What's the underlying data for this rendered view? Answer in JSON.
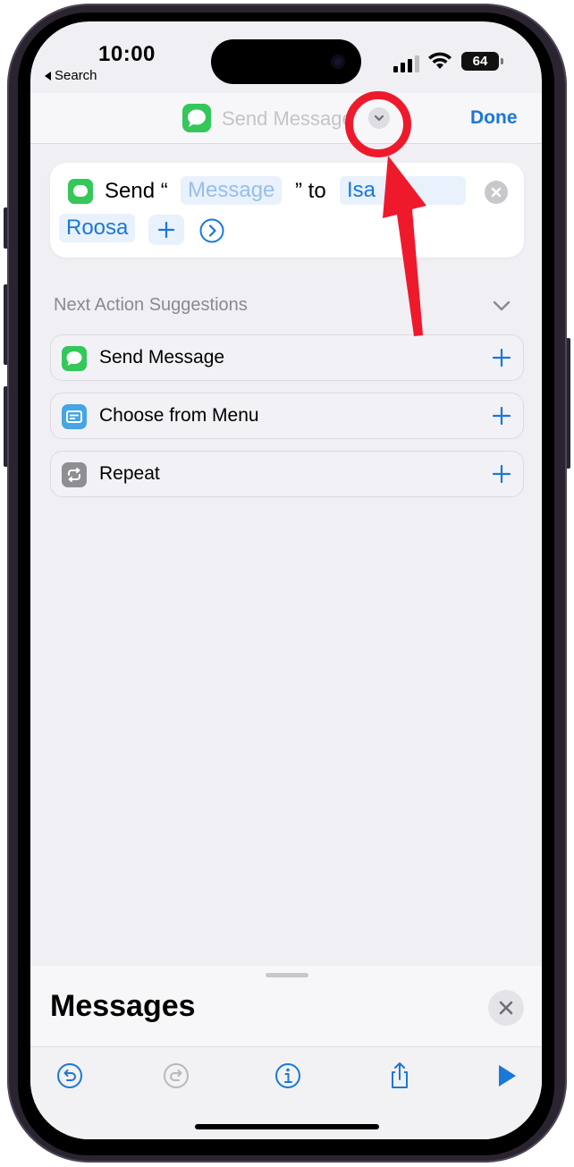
{
  "status_bar": {
    "time": "10:00",
    "back_label": "Search",
    "battery": "64"
  },
  "nav": {
    "title": "Send Message",
    "done_label": "Done"
  },
  "action": {
    "verb": "Send",
    "open_quote": "“",
    "message_placeholder": "Message",
    "close_quote_to": "” to",
    "recipient_first": "Isa",
    "recipient_last": "Roosa"
  },
  "suggestions": {
    "header": "Next Action Suggestions",
    "items": [
      {
        "label": "Send Message",
        "icon": "messages-icon",
        "color": "#34c759"
      },
      {
        "label": "Choose from Menu",
        "icon": "menu-icon",
        "color": "#46a5e4"
      },
      {
        "label": "Repeat",
        "icon": "repeat-icon",
        "color": "#8e8e93"
      }
    ]
  },
  "sheet": {
    "title": "Messages"
  },
  "colors": {
    "accent": "#1a78d8",
    "annotation": "#ee1a2c",
    "messages_green": "#34c759"
  }
}
